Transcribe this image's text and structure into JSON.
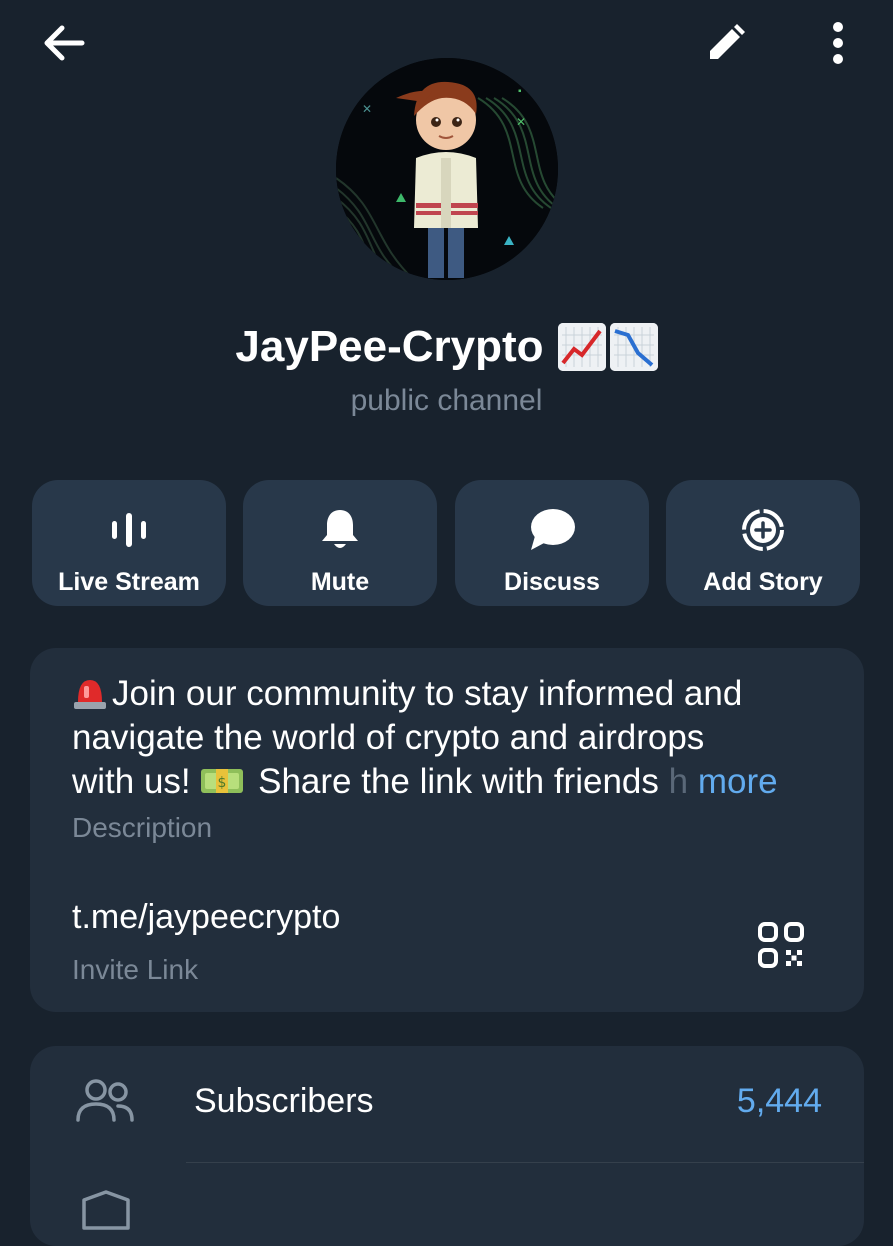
{
  "topbar": {
    "back_icon": "arrow-left-icon",
    "edit_icon": "pencil-icon",
    "more_icon": "more-vertical-icon"
  },
  "channel": {
    "title": "JayPee-Crypto",
    "title_emojis": [
      "chart-increasing-emoji",
      "chart-decreasing-emoji"
    ],
    "subtitle": "public channel"
  },
  "actions": [
    {
      "label": "Live Stream",
      "icon": "live-stream-icon"
    },
    {
      "label": "Mute",
      "icon": "bell-icon"
    },
    {
      "label": "Discuss",
      "icon": "chat-bubble-icon"
    },
    {
      "label": "Add Story",
      "icon": "add-story-icon"
    }
  ],
  "info": {
    "description_lines": [
      "Join our community to stay informed and",
      "navigate the world of crypto and airdrops",
      "with us!",
      "Share the link with friends",
      "h",
      "more"
    ],
    "description_label": "Description",
    "link": "t.me/jaypeecrypto",
    "link_label": "Invite Link"
  },
  "stats": {
    "subscribers_label": "Subscribers",
    "subscribers_value": "5,444"
  },
  "colors": {
    "background": "#18222d",
    "card": "#222e3c",
    "button": "#28384a",
    "accent": "#62abee",
    "muted_text": "#7b8897"
  }
}
